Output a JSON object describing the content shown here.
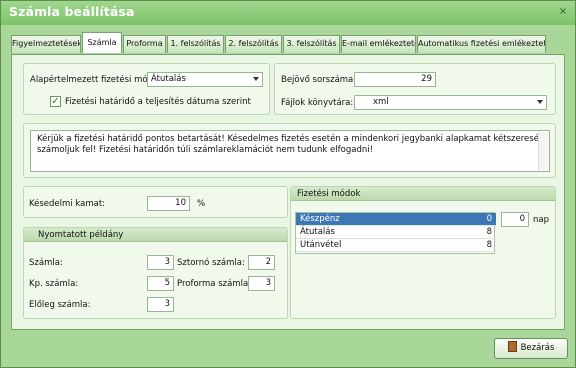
{
  "window": {
    "title": "Számla beállítása",
    "close": "×"
  },
  "tabs": [
    "Figyelmeztetések",
    "Számla",
    "Proforma",
    "1. felszólítás",
    "2. felszólítás",
    "3. felszólítás",
    "E-mail emlékeztető",
    "Automatikus fizetési emlékeztető"
  ],
  "active_tab": "Számla",
  "general": {
    "payment_label": "Alapértelmezett fizetési mód:",
    "payment_value": "Átutalás",
    "deadline_check_label": "Fizetési határidő a teljesítés dátuma szerint",
    "deadline_checked": true
  },
  "serial": {
    "next_label": "Bejövő sorszáma:",
    "next_value": "29",
    "dir_label": "Fájlok könyvtára:",
    "dir_value": "xml"
  },
  "memo": {
    "text": "Kérjük a fizetési határidő pontos betartását! Késedelmes fizetés esetén a mindenkori jegybanki alapkamat kétszeresét számoljuk fel! Fizetési határidőn túli számlareklamációt nem tudunk elfogadni!"
  },
  "interest": {
    "label": "Késedelmi kamat:",
    "value": "10",
    "unit": "%"
  },
  "copies": {
    "title": "Nyomtatott példány",
    "invoice_label": "Számla:",
    "invoice_value": "3",
    "storno_label": "Sztornó számla:",
    "storno_value": "2",
    "cash_label": "Kp. számla:",
    "cash_value": "5",
    "proforma_label": "Proforma számla:",
    "proforma_value": "3",
    "advance_label": "Előleg számla:",
    "advance_value": "3"
  },
  "payment_methods": {
    "title": "Fizetési módok",
    "rows": [
      {
        "name": "Készpénz",
        "value": "0",
        "selected": true
      },
      {
        "name": "Átutalás",
        "value": "8",
        "selected": false
      },
      {
        "name": "Utánvétel",
        "value": "8",
        "selected": false
      }
    ],
    "days_value": "0",
    "days_unit": "nap"
  },
  "footer": {
    "close_button": "Bezárás"
  }
}
